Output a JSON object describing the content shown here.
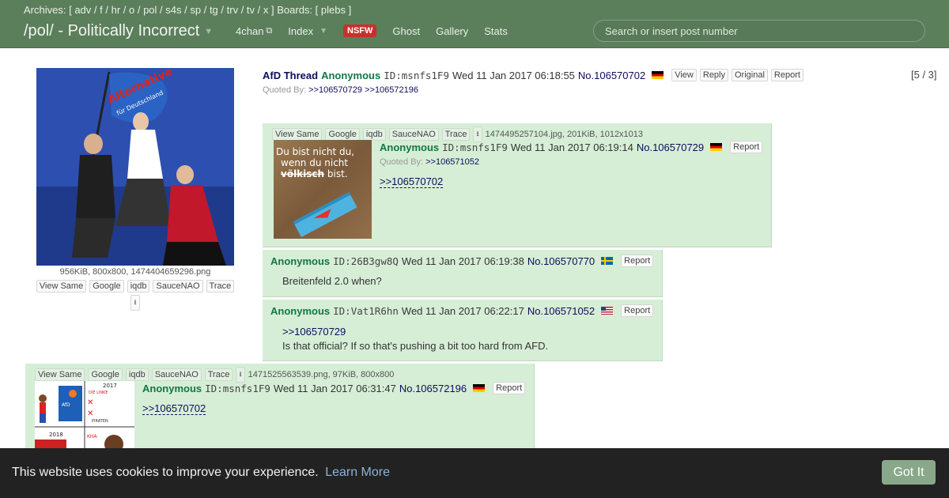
{
  "header": {
    "archives_prefix": "Archives: [",
    "archives": [
      "adv",
      "f",
      "hr",
      "o",
      "pol",
      "s4s",
      "sp",
      "tg",
      "trv",
      "tv",
      "x"
    ],
    "boards_prefix": "] Boards: [",
    "boards": [
      "plebs"
    ],
    "boards_suffix": "]",
    "board_title": "/pol/ - Politically Incorrect",
    "nav": {
      "site": "4chan",
      "index": "Index",
      "nsfw": "NSFW",
      "ghost": "Ghost",
      "gallery": "Gallery",
      "stats": "Stats"
    },
    "search_placeholder": "Search or insert post number"
  },
  "op": {
    "subject": "AfD Thread",
    "name": "Anonymous",
    "id": "ID:msnfs1F9",
    "date": "Wed 11 Jan 2017 06:18:55",
    "number": "No.106570702",
    "flag": "de",
    "buttons": [
      "View",
      "Reply",
      "Original",
      "Report"
    ],
    "counter": "[5 / 3]",
    "quoted_by_label": "Quoted By:",
    "quoted_by": [
      ">>106570729",
      ">>106572196"
    ],
    "fileinfo": "956KiB, 800x800, 1474404659296.png",
    "file_buttons": [
      "View Same",
      "Google",
      "iqdb",
      "SauceNAO",
      "Trace"
    ],
    "image": {
      "flag_text": "Alternative",
      "flag_sub": "für Deutschland"
    }
  },
  "replies": [
    {
      "fileinfo": "1474495257104.jpg, 201KiB, 1012x1013",
      "file_buttons": [
        "View Same",
        "Google",
        "iqdb",
        "SauceNAO",
        "Trace"
      ],
      "name": "Anonymous",
      "id": "ID:msnfs1F9",
      "date": "Wed 11 Jan 2017 06:19:14",
      "number": "No.106570729",
      "flag": "de",
      "report": "Report",
      "quoted_by_label": "Quoted By:",
      "quoted_by": [
        ">>106571052"
      ],
      "quote": ">>106570702",
      "text": "",
      "image": {
        "line1": "Du bist nicht du,",
        "line2": "wenn du nicht",
        "line3_struck": "völkisch",
        "line3_rest": " bist."
      }
    },
    {
      "name": "Anonymous",
      "id": "ID:26B3gw8Q",
      "date": "Wed 11 Jan 2017 06:19:38",
      "number": "No.106570770",
      "flag": "se",
      "report": "Report",
      "text": "Breitenfeld 2.0 when?"
    },
    {
      "name": "Anonymous",
      "id": "ID:Vat1R6hn",
      "date": "Wed 11 Jan 2017 06:22:17",
      "number": "No.106571052",
      "flag": "us",
      "report": "Report",
      "quote": ">>106570729",
      "text": "Is that official? If so that's pushing a bit too hard from AFD."
    },
    {
      "fileinfo": "1471525563539.png, 97KiB, 800x800",
      "file_buttons": [
        "View Same",
        "Google",
        "iqdb",
        "SauceNAO",
        "Trace"
      ],
      "name": "Anonymous",
      "id": "ID:msnfs1F9",
      "date": "Wed 11 Jan 2017 06:31:47",
      "number": "No.106572196",
      "flag": "de",
      "report": "Report",
      "quote": ">>106570702",
      "image": {
        "year_top": "2017",
        "year_bottom": "2018",
        "afd": "AfD",
        "linke": "DIE LINKE",
        "piraten": "PIRATEN",
        "kha": "KHA"
      }
    }
  ],
  "cookie": {
    "message": "This website uses cookies to improve your experience.",
    "learn_more": "Learn More",
    "got_it": "Got It"
  }
}
